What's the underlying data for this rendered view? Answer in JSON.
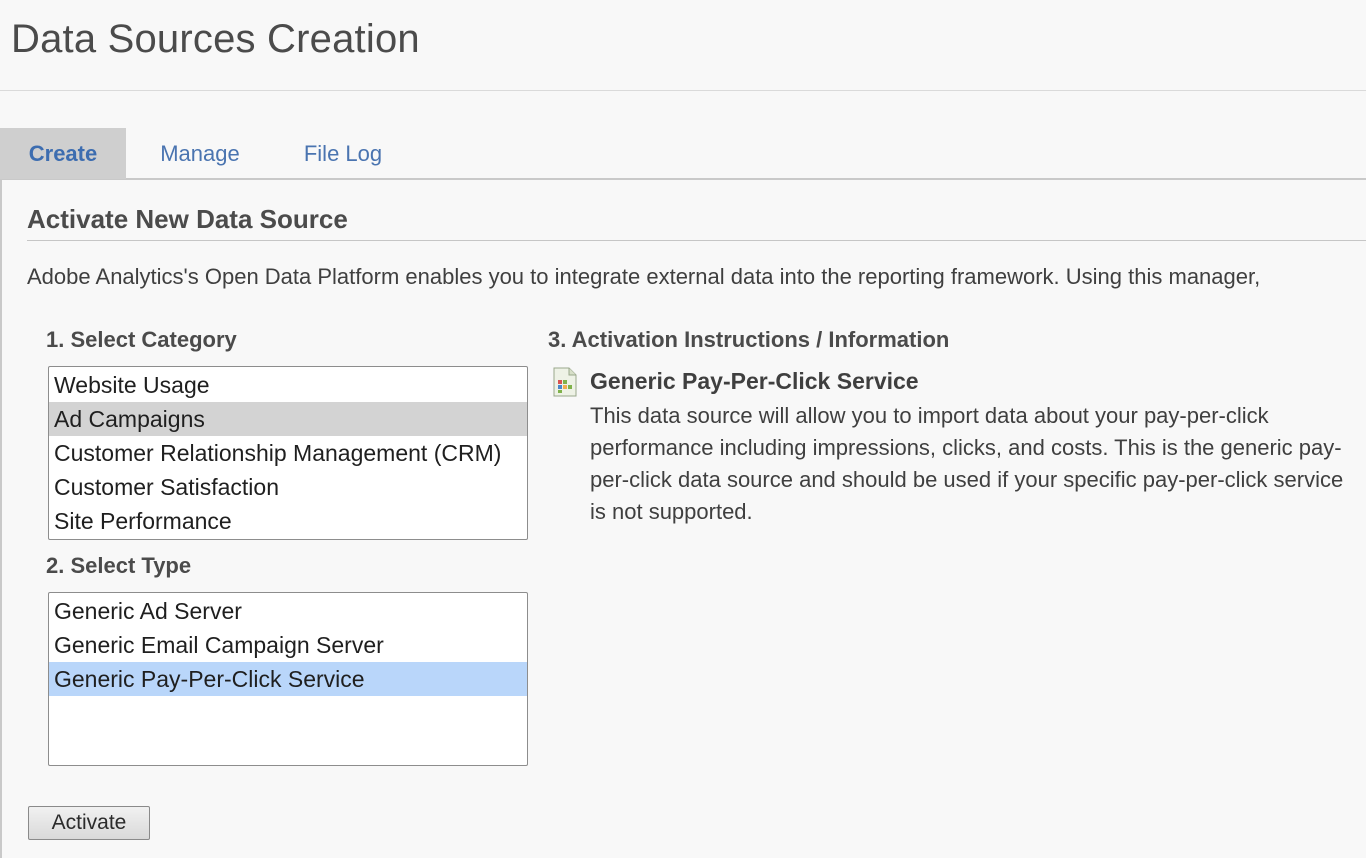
{
  "page": {
    "title": "Data Sources Creation"
  },
  "tabs": [
    {
      "label": "Create",
      "active": true
    },
    {
      "label": "Manage",
      "active": false
    },
    {
      "label": "File Log",
      "active": false
    }
  ],
  "section": {
    "title": "Activate New Data Source",
    "intro": "Adobe Analytics's Open Data Platform enables you to integrate external data into the reporting framework. Using this manager,"
  },
  "category": {
    "label": "1. Select Category",
    "options": [
      "Website Usage",
      "Ad Campaigns",
      "Customer Relationship Management (CRM)",
      "Customer Satisfaction",
      "Site Performance"
    ],
    "selected": "Ad Campaigns"
  },
  "type": {
    "label": "2. Select Type",
    "options": [
      "Generic Ad Server",
      "Generic Email Campaign Server",
      "Generic Pay-Per-Click Service"
    ],
    "selected": "Generic Pay-Per-Click Service"
  },
  "info": {
    "label": "3. Activation Instructions / Information",
    "icon": "data-source-icon",
    "title": "Generic Pay-Per-Click Service",
    "description": "This data source will allow you to import data about your pay-per-click performance including impressions, clicks, and costs. This is the generic pay-per-click data source and should be used if your specific pay-per-click service is not supported."
  },
  "actions": {
    "activate_label": "Activate"
  },
  "colors": {
    "link": "#4a74b0",
    "active_tab_bg": "#cfcfcf",
    "selected_category_bg": "#d3d3d3",
    "selected_type_bg": "#b9d6fa"
  }
}
